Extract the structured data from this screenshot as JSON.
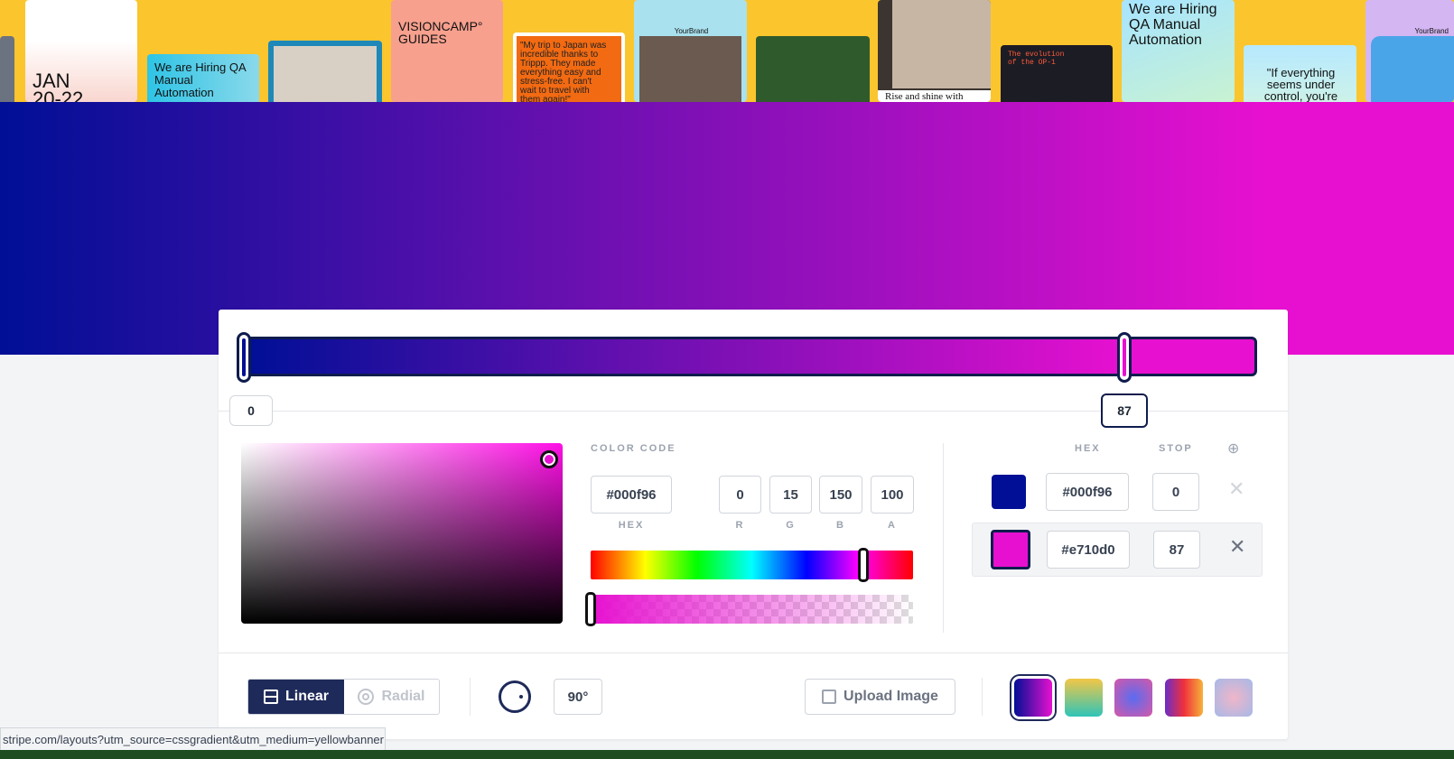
{
  "banner": {
    "cards": [
      {
        "text": "JAN\n20-22"
      },
      {
        "text": "We are Hiring QA\nManual\nAutomation"
      },
      {
        "text": ""
      },
      {
        "text": "VISIONCAMP°\nGUIDES"
      },
      {
        "text": "\"My trip to Japan was\nincredible thanks to\nTrippp. They made\neverything easy and\nstress-free. I can't\nwait to travel with\nthem again!\""
      },
      {
        "text": "YourBrand"
      },
      {
        "text": ""
      },
      {
        "text": "Rise and shine with"
      },
      {
        "text": "The evolution\nof the OP-1"
      },
      {
        "text": "We are Hiring\nQA Manual\nAutomation"
      },
      {
        "text": "\"If everything\nseems under\ncontrol, you're"
      },
      {
        "text": "YourBrand"
      }
    ]
  },
  "gradient": {
    "stops": [
      {
        "hex": "#000f96",
        "stop": "0"
      },
      {
        "hex": "#e710d0",
        "stop": "87"
      }
    ],
    "colors": {
      "start": "#000f96",
      "end": "#e710d0",
      "accent": "#0f1c4d"
    }
  },
  "color_code": {
    "title": "COLOR CODE",
    "hex": "#000f96",
    "r": "0",
    "g": "15",
    "b": "150",
    "a": "100",
    "labels": {
      "hex": "HEX",
      "r": "R",
      "g": "G",
      "b": "B",
      "a": "A"
    }
  },
  "stops_table": {
    "col_hex": "HEX",
    "col_stop": "STOP",
    "add_icon": "plus-circle-icon",
    "close_icon": "close-icon"
  },
  "footer": {
    "linear_label": "Linear",
    "radial_label": "Radial",
    "angle": "90°",
    "upload_label": "Upload Image"
  },
  "status_bar": {
    "url": "stripe.com/layouts?utm_source=cssgradient&utm_medium=yellowbanner"
  }
}
